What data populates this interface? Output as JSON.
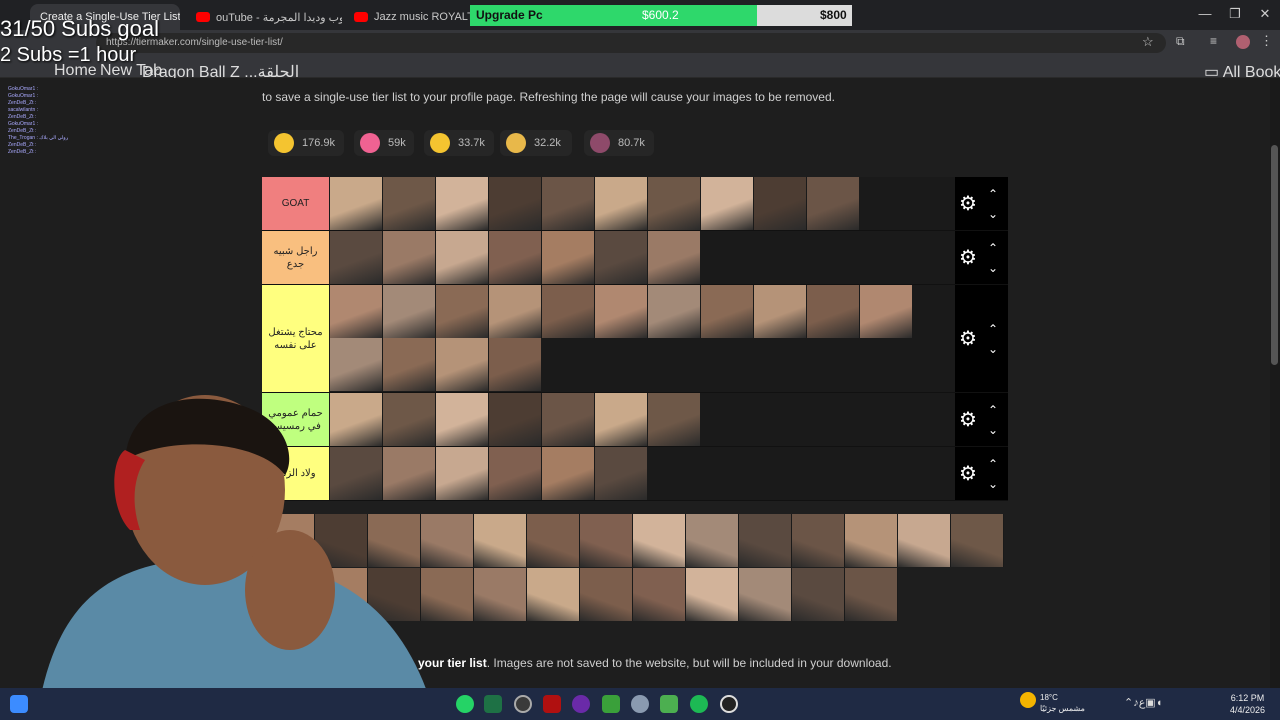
{
  "browser": {
    "tabs": [
      {
        "title": "Create a Single-Use Tier List (P...",
        "active": true
      },
      {
        "title": "ouTube - إيستيوب وديدا المجرمة",
        "active": false
      },
      {
        "title": "Jazz music ROYALTY FREE Bac",
        "active": false
      }
    ],
    "url": "https://tiermaker.com/single-use-tier-list/",
    "bookmarks": [
      "Home",
      "New Tab",
      "Dragon Ball Z ...الحلقة"
    ],
    "all_bookmarks": "All Bookmarks",
    "window_controls": {
      "minimize": "—",
      "maximize": "❐",
      "close": "✕"
    }
  },
  "overlay": {
    "upgrade_label": "Upgrade Pc",
    "current_amount": "$600.2",
    "goal_amount": "$800",
    "progress_fraction": 0.75,
    "goal_line1": "31/50 Subs goal",
    "goal_line2": "2 Subs =1 hour",
    "chat": [
      "GokuOmar1 :",
      "GokuOmar1 :",
      "ZenDeB_Zt :",
      "sacalwilantn :",
      "ZenDeB_Zt :",
      "GokuOmar1 :",
      "ZenDeB_Zt :",
      "The_Trogan : ترولي الي بلاك",
      "ZenDeB_Zt :",
      "ZenDeB_Zt :"
    ]
  },
  "page": {
    "intro_text": "to save a single-use tier list to your profile page. Refreshing the page will cause your images to be removed.",
    "reactions": [
      {
        "icon": "laughing-emoji-icon",
        "count": "176.9k",
        "color": "#f4c430"
      },
      {
        "icon": "heart-eyes-emoji-icon",
        "count": "59k",
        "color": "#f06292"
      },
      {
        "icon": "grin-emoji-icon",
        "count": "33.7k",
        "color": "#f4c430"
      },
      {
        "icon": "praying-hands-icon",
        "count": "32.2k",
        "color": "#e8b84a"
      },
      {
        "icon": "poop-emoji-icon",
        "count": "80.7k",
        "color": "#8e4a6a"
      }
    ],
    "tiers": [
      {
        "label": "GOAT",
        "color": "#f07f7f",
        "count": 10
      },
      {
        "label": "راجل شبيه جدع",
        "color": "#f9bf7f",
        "count": 7
      },
      {
        "label": "محتاج يشتغل على نفسه",
        "color": "#ffff7f",
        "count": 15
      },
      {
        "label": "حمام عمومي في رمسيس",
        "color": "#bfff7f",
        "count": 7
      },
      {
        "label": "ولاد الزناة",
        "color": "#ffff7f",
        "count": 6
      }
    ],
    "pool_count": 26,
    "bottom_bold": "your tier list",
    "bottom_text": ". Images are not saved to the website, but will be included in your download."
  },
  "taskbar": {
    "weather_temp": "18°C",
    "weather_desc": "مشمس جزئيًا",
    "time": "6:12 PM",
    "date": "4/4/2026",
    "lang": "ع"
  },
  "colors": {
    "thumbs": [
      "#c9a98a",
      "#8a6a55",
      "#a57d62",
      "#6e5848",
      "#b59378",
      "#5a4a40",
      "#d2b39a",
      "#7c5e4c",
      "#9a7a66",
      "#4d3d33",
      "#b08870",
      "#c7a890",
      "#6b5547",
      "#a38a78",
      "#806050"
    ]
  }
}
